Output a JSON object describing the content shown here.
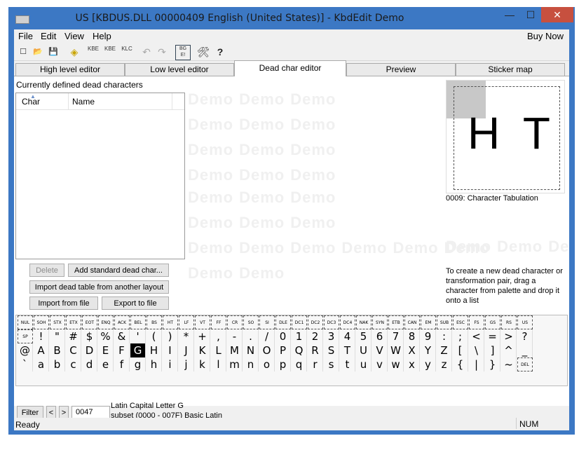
{
  "window": {
    "title": "US [KBDUS.DLL 00000409 English (United States)] - KbdEdit Demo",
    "minimize": "—",
    "maximize": "☐",
    "close": "✕"
  },
  "menu": {
    "file": "File",
    "edit": "Edit",
    "view": "View",
    "help": "Help",
    "buy": "Buy Now"
  },
  "toolbar": {
    "new_icon": "☐",
    "open_icon": "📂",
    "save_icon": "💾",
    "kbe": "KBE",
    "kbe2": "KBE",
    "klc": "KLC",
    "undo": "↶",
    "redo": "↷",
    "tools": "🛠",
    "help": "?"
  },
  "tabs": [
    "High level editor",
    "Low level editor",
    "Dead char editor",
    "Preview",
    "Sticker map"
  ],
  "deadchars": {
    "heading": "Currently defined dead characters",
    "col_char": "Char",
    "col_name": "Name",
    "delete": "Delete",
    "add_standard": "Add standard dead char...",
    "import_table": "Import dead table from another layout",
    "import_file": "Import from file",
    "export_file": "Export to file"
  },
  "preview": {
    "glyph": "H T",
    "caption": "0009: Character Tabulation"
  },
  "hint": "To create a new dead character or transformation pair, drag a character from palette and drop it onto a list",
  "watermark": "Demo",
  "palette": {
    "row0": [
      "NUL",
      "SOH",
      "STX",
      "ETX",
      "EOT",
      "ENQ",
      "ACK",
      "BEL",
      "BS",
      "HT",
      "LF",
      "VT",
      "FF",
      "CR",
      "SO",
      "SI",
      "DLE",
      "DC1",
      "DC2",
      "DC3",
      "DC4",
      "NAK",
      "SYN",
      "ETB",
      "CAN",
      "EM",
      "SUB",
      "ESC",
      "FS",
      "GS",
      "RS",
      "US"
    ],
    "row1": [
      "SP",
      "!",
      "\"",
      "#",
      "$",
      "%",
      "&",
      "'",
      "(",
      ")",
      "*",
      "+",
      ",",
      "-",
      ".",
      "/",
      "0",
      "1",
      "2",
      "3",
      "4",
      "5",
      "6",
      "7",
      "8",
      "9",
      ":",
      ";",
      "<",
      "=",
      ">",
      "?"
    ],
    "row2": [
      "@",
      "A",
      "B",
      "C",
      "D",
      "E",
      "F",
      "G",
      "H",
      "I",
      "J",
      "K",
      "L",
      "M",
      "N",
      "O",
      "P",
      "Q",
      "R",
      "S",
      "T",
      "U",
      "V",
      "W",
      "X",
      "Y",
      "Z",
      "[",
      "\\",
      "]",
      "^",
      "_"
    ],
    "row3": [
      "`",
      "a",
      "b",
      "c",
      "d",
      "e",
      "f",
      "g",
      "h",
      "i",
      "j",
      "k",
      "l",
      "m",
      "n",
      "o",
      "p",
      "q",
      "r",
      "s",
      "t",
      "u",
      "v",
      "w",
      "x",
      "y",
      "z",
      "{",
      "|",
      "}",
      "~",
      "DEL"
    ],
    "selected": "G"
  },
  "filterbar": {
    "filter": "Filter",
    "prev": "<",
    "next": ">",
    "code": "0047",
    "char_name": "Latin Capital Letter G",
    "subset": "subset (0000 - 007F) Basic Latin"
  },
  "status": {
    "ready": "Ready",
    "num": "NUM"
  }
}
